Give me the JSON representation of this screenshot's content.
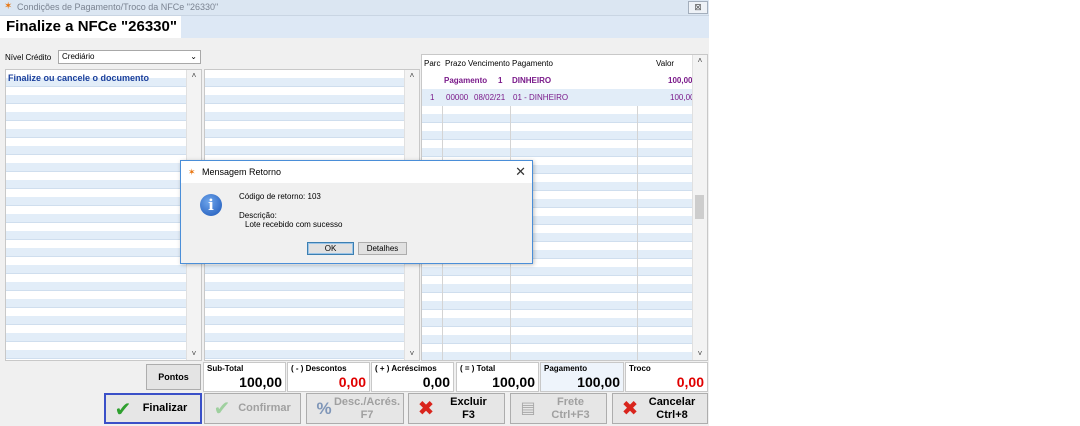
{
  "window": {
    "title": "Condições de Pagamento/Troco da NFCe \"26330\"",
    "close_label": "⊠"
  },
  "header": {
    "title": "Finalize a NFCe \"26330\""
  },
  "nivel_credito": {
    "label": "Nível Crédito",
    "value": "Crediário"
  },
  "left_panel": {
    "message": "Finalize ou cancele o documento"
  },
  "payments_grid": {
    "columns": [
      "Parc",
      "Prazo",
      "Vencimento",
      "Pagamento",
      "Valor"
    ],
    "summary": {
      "label": "Pagamento",
      "count": "1",
      "method": "DINHEIRO",
      "value": "100,00"
    },
    "rows": [
      {
        "parc": "1",
        "prazo": "00000",
        "vencimento": "08/02/21",
        "pagamento": "01 - DINHEIRO",
        "valor": "100,00"
      }
    ]
  },
  "totals": {
    "subtotal": {
      "label": "Sub-Total",
      "value": "100,00"
    },
    "descontos": {
      "label": "( - ) Descontos",
      "value": "0,00"
    },
    "acrescimos": {
      "label": "( + ) Acréscimos",
      "value": "0,00"
    },
    "total": {
      "label": "( = ) Total",
      "value": "100,00"
    },
    "pagamento": {
      "label": "Pagamento",
      "value": "100,00"
    },
    "troco": {
      "label": "Troco",
      "value": "0,00"
    }
  },
  "buttons": {
    "pontos": "Pontos",
    "finalizar": "Finalizar",
    "confirmar": "Confirmar",
    "desc_line1": "Desc./Acrés.",
    "desc_line2": "F7",
    "excluir_line1": "Excluir",
    "excluir_line2": "F3",
    "frete_line1": "Frete",
    "frete_line2": "Ctrl+F3",
    "cancelar_line1": "Cancelar",
    "cancelar_line2": "Ctrl+8"
  },
  "dialog": {
    "title": "Mensagem Retorno",
    "code_line": "Código de retorno: 103",
    "desc_label": "Descrição:",
    "desc_text": "Lote recebido com sucesso",
    "ok_label": "OK",
    "details_label": "Detalhes"
  },
  "colors": {
    "accent_blue": "#1a3f9c",
    "payment_purple": "#7a1a8a",
    "value_red": "#e00000",
    "confirm_green": "#2fa02f",
    "cancel_red": "#d9251d"
  },
  "icons": [
    "app-icon",
    "close-icon",
    "info-icon",
    "check-icon",
    "percent-icon",
    "x-icon",
    "truck-icon",
    "chevron-down-icon",
    "scroll-up-icon",
    "scroll-down-icon"
  ]
}
